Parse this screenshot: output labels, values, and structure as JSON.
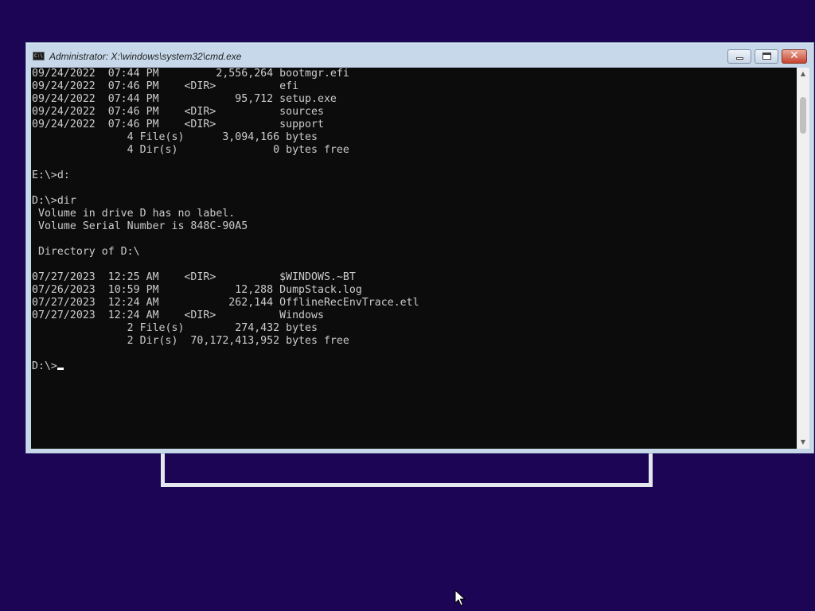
{
  "window": {
    "title": "Administrator: X:\\windows\\system32\\cmd.exe",
    "icon_text": "C:\\",
    "minimize_glyph": "",
    "close_glyph": "✕"
  },
  "console": {
    "lines": [
      "09/24/2022  07:44 PM         2,556,264 bootmgr.efi",
      "09/24/2022  07:46 PM    <DIR>          efi",
      "09/24/2022  07:44 PM            95,712 setup.exe",
      "09/24/2022  07:46 PM    <DIR>          sources",
      "09/24/2022  07:46 PM    <DIR>          support",
      "               4 File(s)      3,094,166 bytes",
      "               4 Dir(s)               0 bytes free",
      "",
      "E:\\>d:",
      "",
      "D:\\>dir",
      " Volume in drive D has no label.",
      " Volume Serial Number is 848C-90A5",
      "",
      " Directory of D:\\",
      "",
      "07/27/2023  12:25 AM    <DIR>          $WINDOWS.~BT",
      "07/26/2023  10:59 PM            12,288 DumpStack.log",
      "07/27/2023  12:24 AM           262,144 OfflineRecEnvTrace.etl",
      "07/27/2023  12:24 AM    <DIR>          Windows",
      "               2 File(s)        274,432 bytes",
      "               2 Dir(s)  70,172,413,952 bytes free",
      "",
      "D:\\>"
    ]
  },
  "scrollbar": {
    "up_arrow": "▲",
    "down_arrow": "▼"
  },
  "colors": {
    "desktop": "#1c0555",
    "console_bg": "#0c0c0c",
    "console_fg": "#cccccc"
  }
}
